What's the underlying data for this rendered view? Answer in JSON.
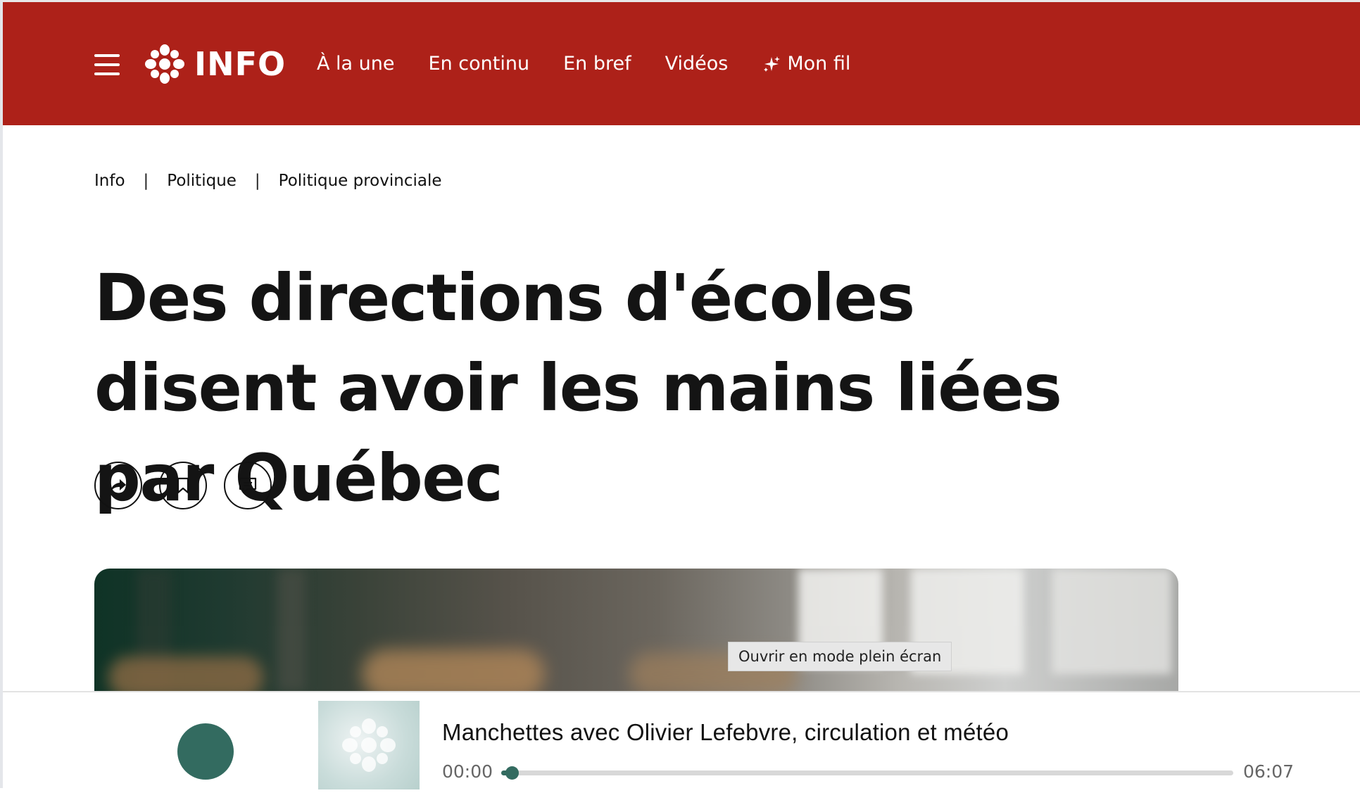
{
  "header": {
    "brand": "INFO",
    "nav": [
      {
        "label": "À la une"
      },
      {
        "label": "En continu"
      },
      {
        "label": "En bref"
      },
      {
        "label": "Vidéos"
      },
      {
        "label": "Mon fil",
        "icon": "sparkle-icon"
      }
    ],
    "background_color": "#ad2119"
  },
  "breadcrumb": {
    "items": [
      "Info",
      "Politique",
      "Politique provinciale"
    ],
    "separator": "|"
  },
  "article": {
    "title": "Des directions d'écoles disent avoir les mains liées par Québec",
    "actions": [
      {
        "icon": "share-icon"
      },
      {
        "icon": "bookmark-icon"
      },
      {
        "icon": "comment-icon"
      }
    ],
    "hero_tooltip": "Ouvrir en mode plein écran"
  },
  "player": {
    "title": "Manchettes avec Olivier Lefebvre, circulation et météo",
    "current_time": "00:00",
    "duration": "06:07",
    "progress_fraction": 0.01,
    "accent_color": "#336b60"
  }
}
